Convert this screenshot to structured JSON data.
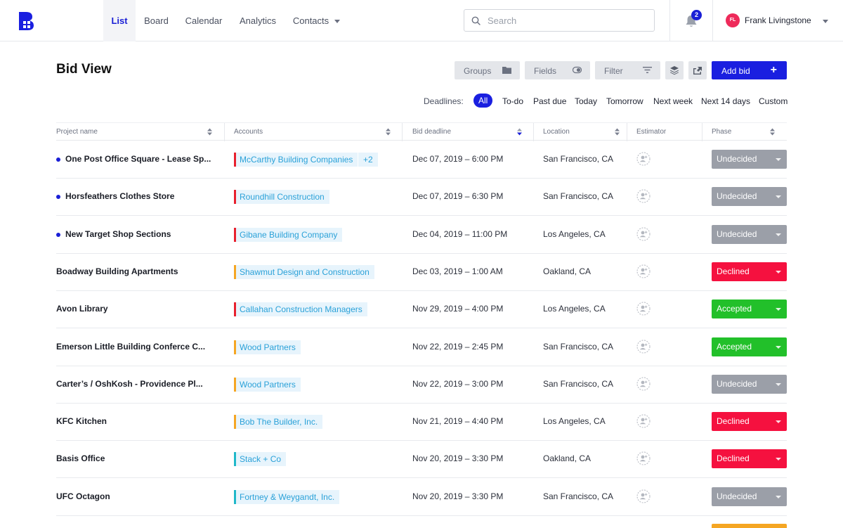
{
  "nav": {
    "tabs": [
      {
        "label": "List",
        "active": true
      },
      {
        "label": "Board"
      },
      {
        "label": "Calendar"
      },
      {
        "label": "Analytics"
      },
      {
        "label": "Contacts",
        "dropdown": true
      }
    ],
    "search_placeholder": "Search",
    "notification_count": "2",
    "user": {
      "initials": "FL",
      "name": "Frank Livingstone"
    }
  },
  "toolbar": {
    "title": "Bid View",
    "groups_label": "Groups",
    "fields_label": "Fields",
    "filter_label": "Filter",
    "add_bid_label": "Add bid"
  },
  "deadlines": {
    "label": "Deadlines:",
    "options": [
      "All",
      "To-do",
      "Past due",
      "Today",
      "Tomorrow",
      "Next week",
      "Next 14 days",
      "Custom"
    ],
    "active": "All"
  },
  "table": {
    "columns": [
      "Project name",
      "Accounts",
      "Bid deadline",
      "Location",
      "Estimator",
      "Phase"
    ],
    "rows": [
      {
        "name": "One Post Office Square - Lease Sp...",
        "unread": true,
        "account": "McCarthy Building Companies",
        "account_color": "#e8202e",
        "extra": "+2",
        "deadline": "Dec 07, 2019 – 6:00 PM",
        "location": "San Francisco, CA",
        "phase": "Undecided"
      },
      {
        "name": "Horsfeathers Clothes Store",
        "unread": true,
        "account": "Roundhill Construction",
        "account_color": "#e8202e",
        "deadline": "Dec 07, 2019 – 6:30 PM",
        "location": "San Francisco, CA",
        "phase": "Undecided"
      },
      {
        "name": "New Target Shop Sections",
        "unread": true,
        "account": "Gibane Building Company",
        "account_color": "#e8202e",
        "deadline": "Dec 04, 2019 – 11:00 PM",
        "location": "Los Angeles, CA",
        "phase": "Undecided"
      },
      {
        "name": "Boadway Building Apartments",
        "unread": false,
        "account": "Shawmut Design and Construction",
        "account_color": "#f5a623",
        "deadline": "Dec 03, 2019 – 1:00 AM",
        "location": "Oakland, CA",
        "phase": "Declined"
      },
      {
        "name": "Avon Library",
        "unread": false,
        "account": "Callahan Construction Managers",
        "account_color": "#e8202e",
        "deadline": "Nov 29, 2019 – 4:00 PM",
        "location": "Los Angeles, CA",
        "phase": "Accepted"
      },
      {
        "name": "Emerson Little Building Conferce C...",
        "unread": false,
        "account": "Wood Partners",
        "account_color": "#f5a623",
        "deadline": "Nov 22, 2019 – 2:45 PM",
        "location": "San Francisco, CA",
        "phase": "Accepted"
      },
      {
        "name": "Carter’s / OshKosh - Providence Pl...",
        "unread": false,
        "account": "Wood Partners",
        "account_color": "#f5a623",
        "deadline": "Nov 22, 2019 – 3:00 PM",
        "location": "San Francisco, CA",
        "phase": "Undecided"
      },
      {
        "name": "KFC Kitchen",
        "unread": false,
        "account": "Bob The Builder, Inc.",
        "account_color": "#f5a623",
        "deadline": "Nov 21, 2019 – 4:40 PM",
        "location": "Los Angeles, CA",
        "phase": "Declined"
      },
      {
        "name": "Basis Office",
        "unread": false,
        "account": "Stack + Co",
        "account_color": "#1fb8c9",
        "deadline": "Nov 20, 2019 – 3:30 PM",
        "location": "Oakland, CA",
        "phase": "Declined"
      },
      {
        "name": "UFC Octagon",
        "unread": false,
        "account": "Fortney & Weygandt, Inc.",
        "account_color": "#1fb8c9",
        "deadline": "Nov 20, 2019 – 3:30 PM",
        "location": "San Francisco, CA",
        "phase": "Undecided"
      }
    ]
  },
  "phase_colors": {
    "Undecided": "#9b9fa8",
    "Declined": "#f5113f",
    "Accepted": "#22c02a"
  },
  "colors": {
    "primary": "#1a1fe0",
    "account_text": "#2aa1d8",
    "account_bg": "#e7f4fc"
  }
}
